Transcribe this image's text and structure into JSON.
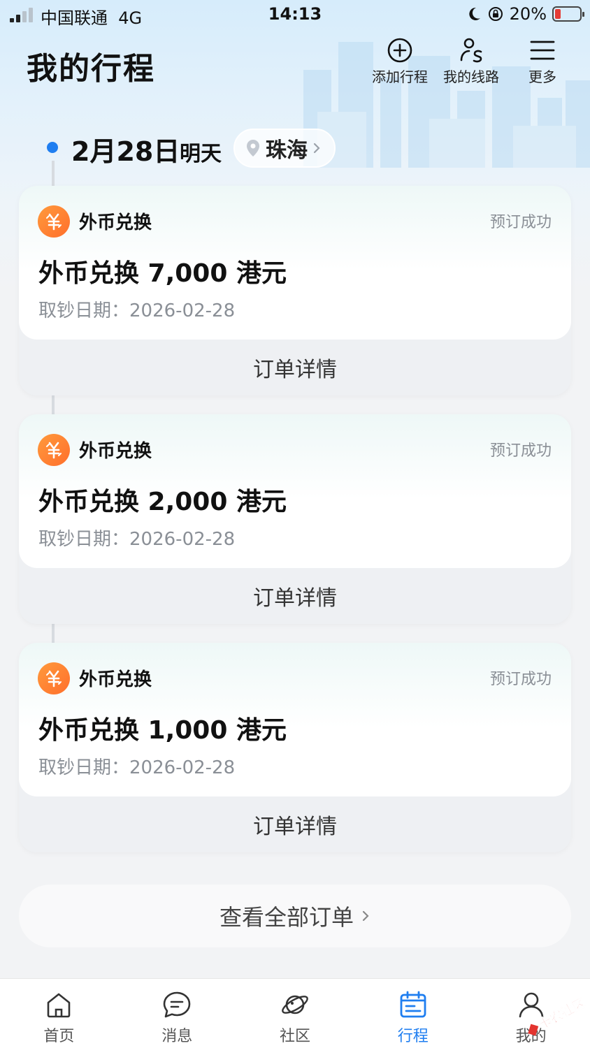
{
  "status_bar": {
    "carrier": "中国联通",
    "network": "4G",
    "time": "14:13",
    "battery": "20%",
    "battery_level": 0.2
  },
  "header": {
    "title": "我的行程",
    "actions": [
      {
        "label": "添加行程",
        "icon": "plus-circle-icon"
      },
      {
        "label": "我的线路",
        "icon": "route-person-icon"
      },
      {
        "label": "更多",
        "icon": "menu-icon"
      }
    ]
  },
  "timeline": {
    "date": "2月28日",
    "day": "明天",
    "city": "珠海"
  },
  "orders": [
    {
      "service": "外币兑换",
      "status": "预订成功",
      "title": "外币兑换 7,000 港元",
      "date_label": "取钞日期：",
      "date": "2026-02-28",
      "detail_label": "订单详情"
    },
    {
      "service": "外币兑换",
      "status": "预订成功",
      "title": "外币兑换 2,000 港元",
      "date_label": "取钞日期：",
      "date": "2026-02-28",
      "detail_label": "订单详情"
    },
    {
      "service": "外币兑换",
      "status": "预订成功",
      "title": "外币兑换 1,000 港元",
      "date_label": "取钞日期：",
      "date": "2026-02-28",
      "detail_label": "订单详情"
    }
  ],
  "all_orders_label": "查看全部订单",
  "tabbar": [
    {
      "label": "首页",
      "icon": "home-icon"
    },
    {
      "label": "消息",
      "icon": "message-icon"
    },
    {
      "label": "社区",
      "icon": "planet-icon"
    },
    {
      "label": "行程",
      "icon": "calendar-icon",
      "active": true
    },
    {
      "label": "我的",
      "icon": "user-icon"
    }
  ],
  "watermark": "卡农社区",
  "colors": {
    "accent": "#1f7ef0",
    "service_icon": "#ff7a2f",
    "battery_low": "#e43b35"
  }
}
